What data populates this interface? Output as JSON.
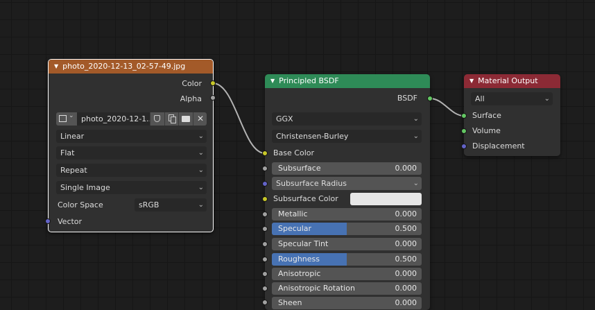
{
  "image_node": {
    "title": "photo_2020-12-13_02-57-49.jpg",
    "header_color": "#a35a29",
    "outputs": [
      "Color",
      "Alpha"
    ],
    "image_name": "photo_2020-12-1...",
    "interpolation": "Linear",
    "projection": "Flat",
    "extension": "Repeat",
    "source": "Single Image",
    "color_space_label": "Color Space",
    "color_space": "sRGB",
    "input_vector": "Vector"
  },
  "bsdf_node": {
    "title": "Principled BSDF",
    "header_color": "#2e8b57",
    "output": "BSDF",
    "distribution": "GGX",
    "subsurface_method": "Christensen-Burley",
    "base_color_label": "Base Color",
    "subsurface_label": "Subsurface",
    "subsurface_value": "0.000",
    "subsurface_radius_label": "Subsurface Radius",
    "subsurface_color_label": "Subsurface Color",
    "subsurface_color": "#e6e6e6",
    "metallic_label": "Metallic",
    "metallic_value": "0.000",
    "specular_label": "Specular",
    "specular_value": "0.500",
    "specular_fill": 0.5,
    "specular_tint_label": "Specular Tint",
    "specular_tint_value": "0.000",
    "roughness_label": "Roughness",
    "roughness_value": "0.500",
    "roughness_fill": 0.5,
    "anisotropic_label": "Anisotropic",
    "anisotropic_value": "0.000",
    "aniso_rotation_label": "Anisotropic Rotation",
    "aniso_rotation_value": "0.000",
    "sheen_label": "Sheen",
    "sheen_value": "0.000"
  },
  "output_node": {
    "title": "Material Output",
    "header_color": "#8c2a35",
    "target": "All",
    "inputs": [
      "Surface",
      "Volume",
      "Displacement"
    ]
  },
  "colors": {
    "socket_color": "#c7c729",
    "socket_float": "#a1a1a1",
    "socket_vector": "#6363c7",
    "socket_shader": "#63c763",
    "slider_fill": "#4772b3"
  }
}
